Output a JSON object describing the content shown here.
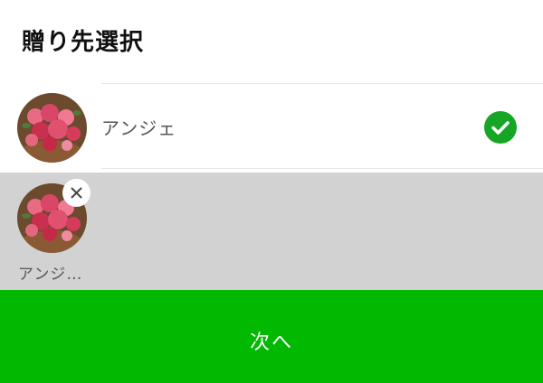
{
  "header": {
    "title": "贈り先選択"
  },
  "friends": [
    {
      "name": "アンジェ",
      "selected": true
    }
  ],
  "selected_recipients": [
    {
      "name_truncated": "アンジ…"
    }
  ],
  "footer": {
    "next_label": "次へ"
  },
  "colors": {
    "accent_green": "#00b900",
    "check_green": "#14a624",
    "selected_area_bg": "#d2d2d2"
  },
  "icons": {
    "check": "check-icon",
    "remove": "close-icon",
    "avatar": "flower-bouquet-photo"
  }
}
